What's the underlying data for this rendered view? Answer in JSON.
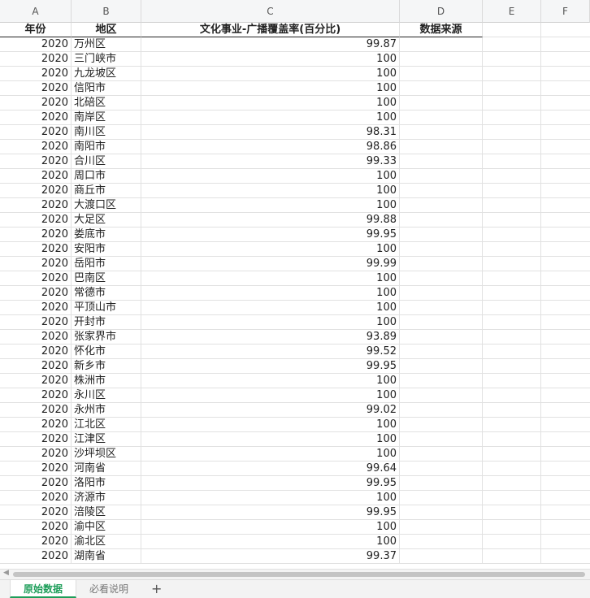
{
  "column_letters": [
    "A",
    "B",
    "C",
    "D",
    "E",
    "F"
  ],
  "headers": [
    "年份",
    "地区",
    "文化事业-广播覆盖率(百分比)",
    "数据来源"
  ],
  "rows": [
    [
      "2020",
      "万州区",
      "99.87"
    ],
    [
      "2020",
      "三门峡市",
      "100"
    ],
    [
      "2020",
      "九龙坡区",
      "100"
    ],
    [
      "2020",
      "信阳市",
      "100"
    ],
    [
      "2020",
      "北碚区",
      "100"
    ],
    [
      "2020",
      "南岸区",
      "100"
    ],
    [
      "2020",
      "南川区",
      "98.31"
    ],
    [
      "2020",
      "南阳市",
      "98.86"
    ],
    [
      "2020",
      "合川区",
      "99.33"
    ],
    [
      "2020",
      "周口市",
      "100"
    ],
    [
      "2020",
      "商丘市",
      "100"
    ],
    [
      "2020",
      "大渡口区",
      "100"
    ],
    [
      "2020",
      "大足区",
      "99.88"
    ],
    [
      "2020",
      "娄底市",
      "99.95"
    ],
    [
      "2020",
      "安阳市",
      "100"
    ],
    [
      "2020",
      "岳阳市",
      "99.99"
    ],
    [
      "2020",
      "巴南区",
      "100"
    ],
    [
      "2020",
      "常德市",
      "100"
    ],
    [
      "2020",
      "平顶山市",
      "100"
    ],
    [
      "2020",
      "开封市",
      "100"
    ],
    [
      "2020",
      "张家界市",
      "93.89"
    ],
    [
      "2020",
      "怀化市",
      "99.52"
    ],
    [
      "2020",
      "新乡市",
      "99.95"
    ],
    [
      "2020",
      "株洲市",
      "100"
    ],
    [
      "2020",
      "永川区",
      "100"
    ],
    [
      "2020",
      "永州市",
      "99.02"
    ],
    [
      "2020",
      "江北区",
      "100"
    ],
    [
      "2020",
      "江津区",
      "100"
    ],
    [
      "2020",
      "沙坪坝区",
      "100"
    ],
    [
      "2020",
      "河南省",
      "99.64"
    ],
    [
      "2020",
      "洛阳市",
      "99.95"
    ],
    [
      "2020",
      "济源市",
      "100"
    ],
    [
      "2020",
      "涪陵区",
      "99.95"
    ],
    [
      "2020",
      "渝中区",
      "100"
    ],
    [
      "2020",
      "渝北区",
      "100"
    ],
    [
      "2020",
      "湖南省",
      "99.37"
    ]
  ],
  "tabs": [
    {
      "label": "原始数据",
      "active": true
    },
    {
      "label": "必看说明",
      "active": false
    }
  ],
  "add_tab_label": "+"
}
